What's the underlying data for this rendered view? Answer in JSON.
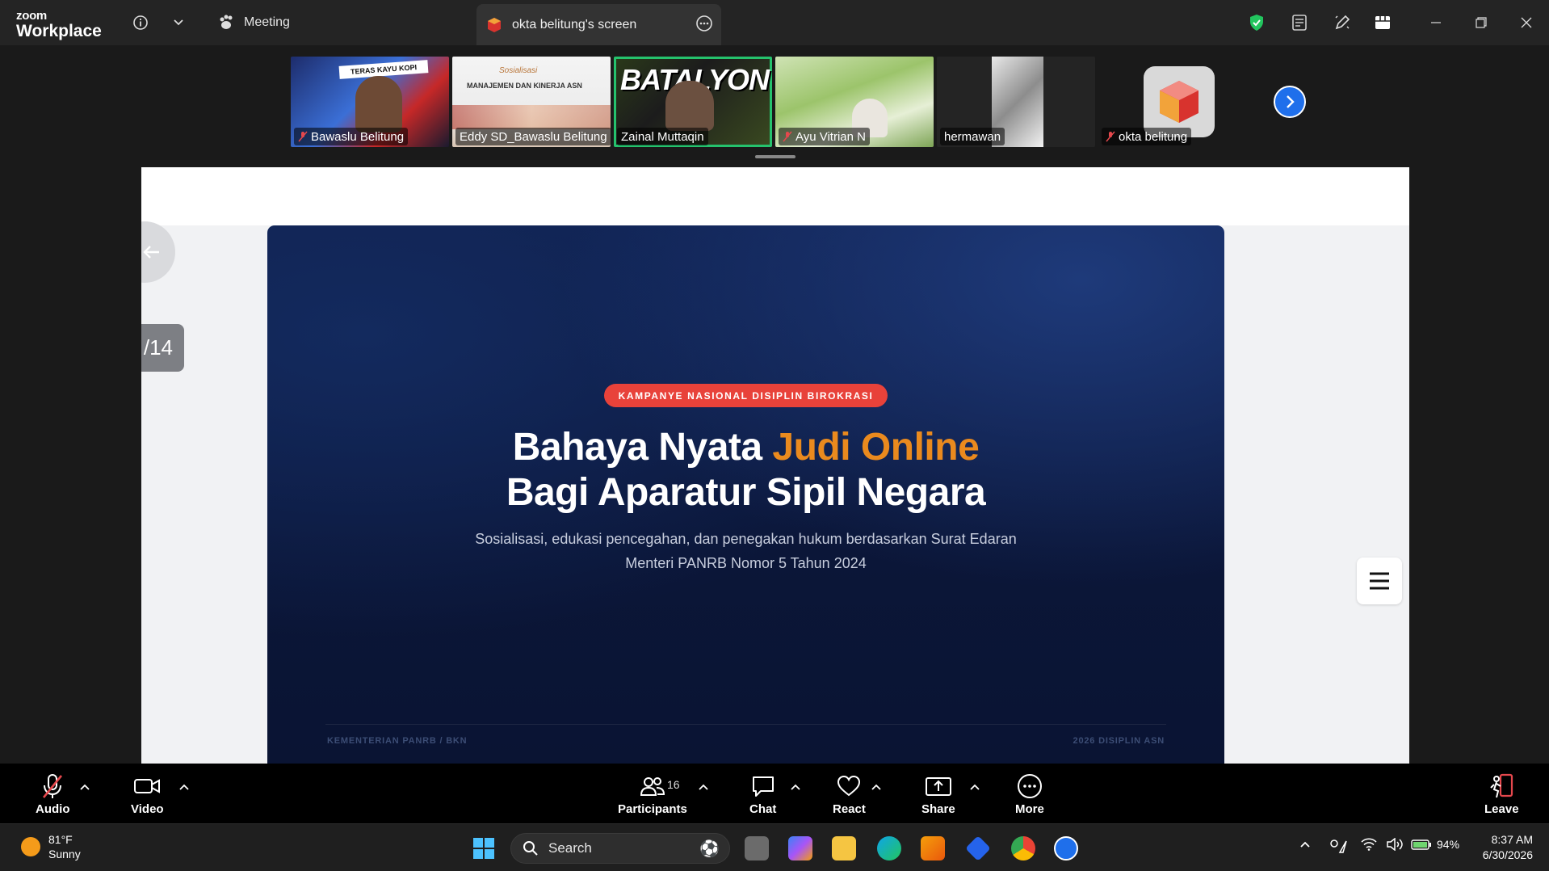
{
  "titlebar": {
    "logo_top": "zoom",
    "logo_bottom": "Workplace",
    "meeting_label": "Meeting",
    "screen_tab_label": "okta belitung's screen"
  },
  "participants_strip": [
    {
      "name": "Bawaslu Belitung",
      "muted": true
    },
    {
      "name": "Eddy SD_Bawaslu Belitung",
      "muted": false
    },
    {
      "name": "Zainal Muttaqin",
      "muted": false,
      "active": true
    },
    {
      "name": "Ayu Vitrian N",
      "muted": true
    },
    {
      "name": "hermawan",
      "muted": false
    },
    {
      "name": "okta belitung",
      "muted": true
    }
  ],
  "thumb_text": {
    "teras": "TERAS KAYU KOPI",
    "manajemen": "MANAJEMEN DAN KINERJA ASN",
    "sosialisasi": "Sosialisasi",
    "batalyon": "BATALYON"
  },
  "share": {
    "page_indicator": "/14",
    "badge": "KAMPANYE NASIONAL DISIPLIN BIROKRASI",
    "headline_part1": "Bahaya Nyata ",
    "headline_accent": "Judi Online",
    "headline_line2": "Bagi Aparatur Sipil Negara",
    "sub_line1": "Sosialisasi, edukasi pencegahan, dan penegakan hukum berdasarkan Surat Edaran",
    "sub_line2": "Menteri PANRB Nomor 5 Tahun 2024",
    "footer_left": "KEMENTERIAN PANRB / BKN",
    "footer_right": "2026 DISIPLIN ASN"
  },
  "toolbar": {
    "audio": "Audio",
    "video": "Video",
    "participants": "Participants",
    "participants_count": "16",
    "chat": "Chat",
    "react": "React",
    "share": "Share",
    "more": "More",
    "leave": "Leave"
  },
  "taskbar": {
    "temperature": "81°F",
    "condition": "Sunny",
    "search_placeholder": "Search",
    "battery": "94%",
    "time": "8:37 AM",
    "date": "6/30/2026"
  },
  "colors": {
    "accent_orange": "#ea8a1e",
    "badge_red": "#e8423a",
    "active_speaker": "#25c26d",
    "zoom_blue": "#1f6feb",
    "leave_red": "#e5484d"
  }
}
